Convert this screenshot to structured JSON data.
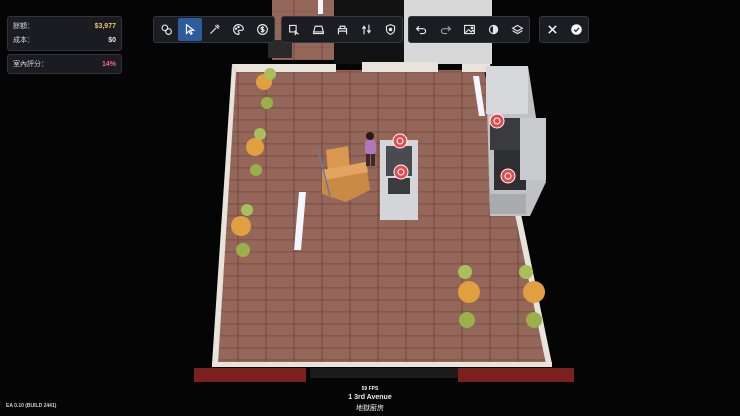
{
  "stats": {
    "money_label": "餘額：",
    "money_value": "$3,977",
    "cost_label": "成本：",
    "cost_value": "$0",
    "rating_label": "室內評分：",
    "rating_value": "14%"
  },
  "toolbar": {
    "groups": [
      [
        "objects-icon",
        "select-icon",
        "eyedropper-icon",
        "paint-icon",
        "money-icon"
      ],
      [
        "place-icon",
        "counter-icon",
        "station-icon",
        "route-icon",
        "shield-icon"
      ],
      [
        "undo-icon",
        "redo-icon",
        "image-icon",
        "lighting-icon",
        "layers-icon"
      ],
      [
        "close-icon",
        "confirm-icon"
      ]
    ],
    "active": "select-icon"
  },
  "footer": {
    "fps": "59 FPS",
    "location": "1 3rd Avenue",
    "room": "地獄廚房"
  },
  "build": "EA 0.10 (BUILD 2441)",
  "colors": {
    "panel_bg": "#1a1c22",
    "accent_blue": "#2d5c9c",
    "money": "#e6c46a",
    "rating": "#f06a8a",
    "marker_red": "#e5484d"
  }
}
